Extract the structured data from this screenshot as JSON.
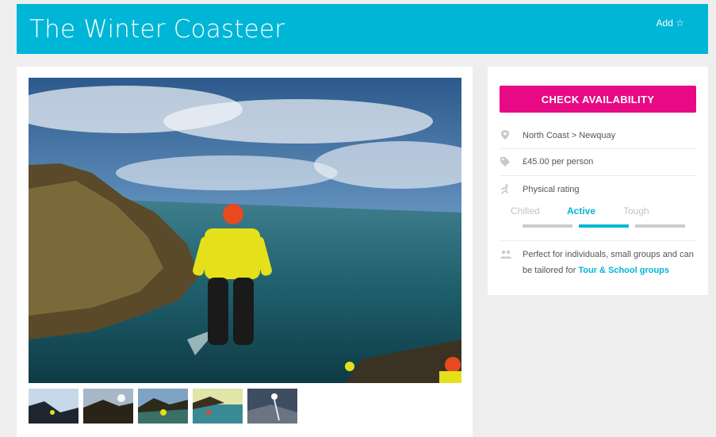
{
  "header": {
    "title": "The Winter Coasteer",
    "add_label": "Add ☆"
  },
  "gallery": {
    "thumbnails": [
      {
        "name": "thumb-1"
      },
      {
        "name": "thumb-2"
      },
      {
        "name": "thumb-3"
      },
      {
        "name": "thumb-4"
      },
      {
        "name": "thumb-5"
      }
    ]
  },
  "info": {
    "cta_label": "CHECK AVAILABILITY",
    "location": "North Coast > Newquay",
    "price": "£45.00 per person",
    "physical_rating_label": "Physical rating",
    "rating_levels": [
      "Chilled",
      "Active",
      "Tough"
    ],
    "selected_rating": "Active",
    "groups_text": "Perfect for individuals, small groups and can be tailored for",
    "groups_link": "Tour & School groups"
  },
  "icons": {
    "location": "map-pin-icon",
    "price": "price-tag-icon",
    "rating": "runner-icon",
    "groups": "people-icon"
  },
  "colors": {
    "brand": "#00b6d6",
    "cta": "#e80a84"
  }
}
